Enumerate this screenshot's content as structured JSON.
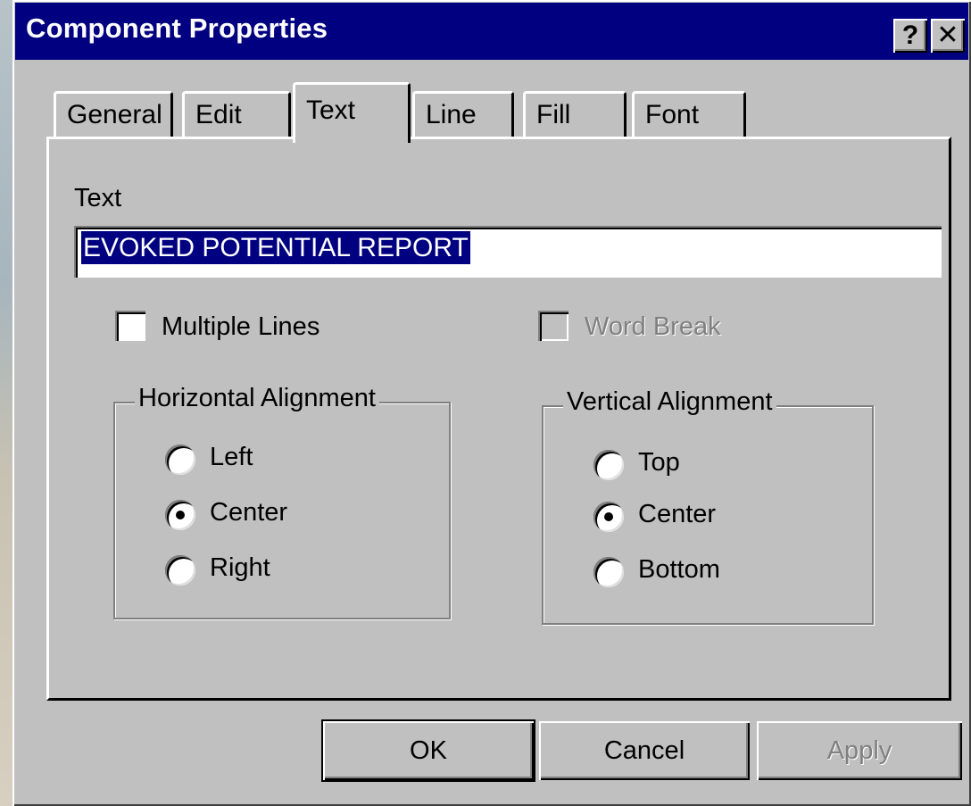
{
  "window": {
    "title": "Component Properties",
    "help_glyph": "?",
    "close_glyph": "✕"
  },
  "tabs": [
    {
      "label": "General"
    },
    {
      "label": "Edit"
    },
    {
      "label": "Text",
      "active": true
    },
    {
      "label": "Line"
    },
    {
      "label": "Fill"
    },
    {
      "label": "Font"
    }
  ],
  "text_section": {
    "label": "Text",
    "value": "EVOKED POTENTIAL REPORT"
  },
  "options": {
    "multiple_lines": {
      "label": "Multiple Lines",
      "checked": false,
      "enabled": true
    },
    "word_break": {
      "label": "Word Break",
      "checked": false,
      "enabled": false
    }
  },
  "horizontal_alignment": {
    "legend": "Horizontal Alignment",
    "options": [
      "Left",
      "Center",
      "Right"
    ],
    "selected": "Center"
  },
  "vertical_alignment": {
    "legend": "Vertical Alignment",
    "options": [
      "Top",
      "Center",
      "Bottom"
    ],
    "selected": "Center"
  },
  "buttons": {
    "ok": "OK",
    "cancel": "Cancel",
    "apply": "Apply"
  },
  "colors": {
    "titlebar": "#000080",
    "face": "#c0c0c0",
    "selection": "#000080"
  }
}
